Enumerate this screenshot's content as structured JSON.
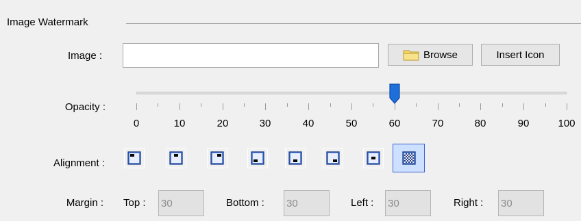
{
  "group": {
    "title": "Image Watermark"
  },
  "image": {
    "label": "Image :",
    "value": "",
    "placeholder": ""
  },
  "buttons": {
    "browse": "Browse",
    "insert_icon": "Insert Icon"
  },
  "opacity": {
    "label": "Opacity :",
    "value": 60,
    "min": 0,
    "max": 100,
    "tick_labels": [
      "0",
      "10",
      "20",
      "30",
      "40",
      "50",
      "60",
      "70",
      "80",
      "90",
      "100"
    ]
  },
  "alignment": {
    "label": "Alignment :",
    "options": [
      "top-left",
      "top-center",
      "top-right",
      "bottom-left",
      "bottom-center",
      "bottom-right",
      "center",
      "tile"
    ],
    "selected": "tile"
  },
  "margin": {
    "label": "Margin :",
    "top_label": "Top :",
    "top": "30",
    "bottom_label": "Bottom :",
    "bottom": "30",
    "left_label": "Left :",
    "left": "30",
    "right_label": "Right :",
    "right": "30"
  },
  "colors": {
    "accent": "#1a5fd6",
    "thumb": "#1e6fd9",
    "disabled_field": "#e2e2e2"
  },
  "icons": {
    "browse": "folder-icon",
    "thumb": "slider-thumb"
  }
}
